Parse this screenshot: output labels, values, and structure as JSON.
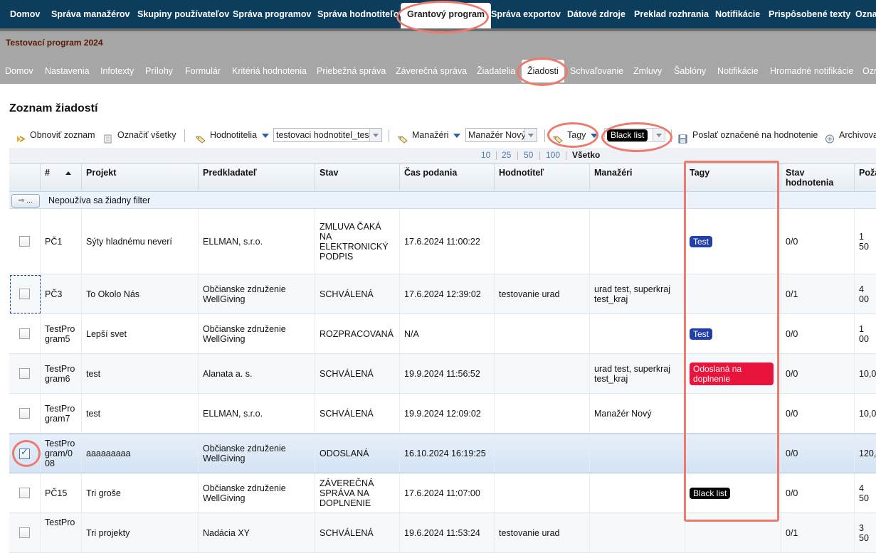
{
  "topnav": {
    "items": [
      "Domov",
      "Správa manažérov",
      "Skupiny používateľov",
      "Správa programov",
      "Správa hodnotiteľov",
      "Grantový program",
      "Správa exportov",
      "Dátové zdroje",
      "Preklad rozhrania",
      "Notifikácie",
      "Prispôsobené texty",
      "Ozna"
    ],
    "active_index": 5
  },
  "program": {
    "title": "Testovací program 2024",
    "subnav": [
      "Domov",
      "Nastavenia",
      "Infotexty",
      "Prílohy",
      "Formulár",
      "Kritériá hodnotenia",
      "Priebežná správa",
      "Záverečná správa",
      "Žiadatelia",
      "Žiadosti",
      "Schvaľovanie",
      "Zmluvy",
      "Šablóny",
      "Notifikácie",
      "Hromadné notifikácie",
      "Ozn"
    ],
    "active_index": 9
  },
  "page_title": "Zoznam žiadostí",
  "toolbar": {
    "refresh_label": "Obnoviť zoznam",
    "select_all_label": "Označiť všetky",
    "evaluators_label": "Hodnotitelia",
    "evaluator_value": "testovaci hodnotitel_test",
    "managers_label": "Manažéri",
    "manager_value": "Manažér Nový",
    "tags_label": "Tagy",
    "tag_value": "Black list",
    "send_label": "Poslať označené na hodnotenie",
    "archive_label": "Archivova"
  },
  "pager": {
    "sizes": [
      "10",
      "25",
      "50",
      "100"
    ],
    "all_label": "Všetko"
  },
  "columns": [
    "#",
    "Projekt",
    "Predkladateľ",
    "Stav",
    "Čas podania",
    "Hodnotiteľ",
    "Manažéri",
    "Tagy",
    "Stav hodnotenia",
    "Poža"
  ],
  "filter": {
    "button_label": "...",
    "text": "Nepoužíva sa žiadny filter"
  },
  "rows": [
    {
      "id": "PČ1",
      "project": "Sýty hladnému neverí",
      "applicant": "ELLMAN, s.r.o.",
      "status": "ZMLUVA ČAKÁ NA ELEKTRONICKÝ PODPIS",
      "submitted": "17.6.2024 11:00:22",
      "evaluator": "",
      "managers": "",
      "tag": "Test",
      "eval_status": "0/0",
      "amount": "1 50",
      "checked": false
    },
    {
      "id": "PČ3",
      "project": "To Okolo Nás",
      "applicant": "Občianske združenie WellGiving",
      "status": "SCHVÁLENÁ",
      "submitted": "17.6.2024 12:39:02",
      "evaluator": "testovanie urad",
      "managers": "urad test, superkraj test_kraj",
      "tag": "",
      "eval_status": "0/1",
      "amount": "4 00",
      "checked": false
    },
    {
      "id": "TestProgram5",
      "project": "Lepší svet",
      "applicant": "Občianske združenie WellGiving",
      "status": "ROZPRACOVANÁ",
      "submitted": "N/A",
      "evaluator": "",
      "managers": "",
      "tag": "Test",
      "eval_status": "0/0",
      "amount": "1 00",
      "checked": false
    },
    {
      "id": "TestProgram6",
      "project": "test",
      "applicant": "Alanata a. s.",
      "status": "SCHVÁLENÁ",
      "submitted": "19.9.2024 11:56:52",
      "evaluator": "",
      "managers": "urad test, superkraj test_kraj",
      "tag": "Odoslaná na doplnenie",
      "eval_status": "0/0",
      "amount": "10,0",
      "checked": false
    },
    {
      "id": "TestProgram7",
      "project": "test",
      "applicant": "ELLMAN, s.r.o.",
      "status": "SCHVÁLENÁ",
      "submitted": "19.9.2024 12:09:02",
      "evaluator": "",
      "managers": "Manažér Nový",
      "tag": "",
      "eval_status": "0/0",
      "amount": "10,0",
      "checked": false
    },
    {
      "id": "TestProgram/008",
      "project": "aaaaaaaaa",
      "applicant": "Občianske združenie WellGiving",
      "status": "ODOSLANÁ",
      "submitted": "16.10.2024 16:19:25",
      "evaluator": "",
      "managers": "",
      "tag": "",
      "eval_status": "0/0",
      "amount": "120,",
      "checked": true
    },
    {
      "id": "PČ15",
      "project": "Tri groše",
      "applicant": "Občianske združenie WellGiving",
      "status": "ZÁVEREČNÁ SPRÁVA NA DOPLNENIE",
      "submitted": "17.6.2024 11:07:00",
      "evaluator": "",
      "managers": "",
      "tag": "Black list",
      "eval_status": "0/0",
      "amount": "4 50",
      "checked": false
    },
    {
      "id": "TestPro",
      "project": "Tri projekty",
      "applicant": "Nadácia XY",
      "status": "SCHVÁLENÁ",
      "submitted": "19.6.2024 11:53:24",
      "evaluator": "testovanie urad",
      "managers": "",
      "tag": "",
      "eval_status": "0/1",
      "amount": "3 50",
      "checked": false
    }
  ],
  "colors": {
    "topnav_bg": "#0d3d5c",
    "annotation": "#ee7a6e",
    "tag_test": "#2340a8",
    "tag_red": "#e8143c",
    "tag_black": "#000000"
  }
}
